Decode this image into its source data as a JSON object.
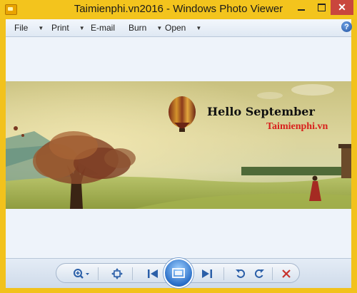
{
  "window": {
    "title": "Taimienphi.vn2016 - Windows Photo Viewer",
    "controls": {
      "close": "✕"
    }
  },
  "menu": {
    "file": "File",
    "print": "Print",
    "email": "E-mail",
    "burn": "Burn",
    "open": "Open",
    "help": "?"
  },
  "photo": {
    "headline": "Hello September",
    "watermark": "Taimienphi.vn"
  },
  "toolbar": {
    "icons": [
      "zoom-icon",
      "actual-size-icon",
      "previous-icon",
      "slideshow-icon",
      "next-icon",
      "rotate-left-icon",
      "rotate-right-icon",
      "delete-icon"
    ]
  },
  "colors": {
    "titlebar": "#f3c41d",
    "close_button": "#c9463d",
    "accent_blue": "#2b5fa8",
    "delete_red": "#c8332d"
  }
}
